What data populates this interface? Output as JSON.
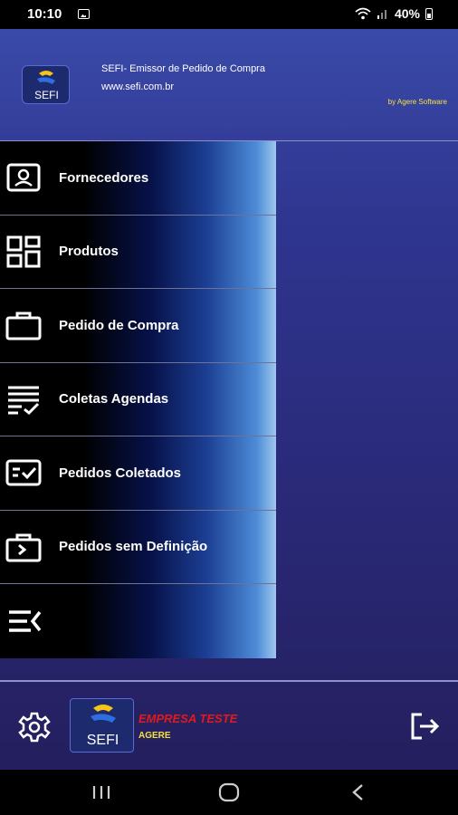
{
  "status_bar": {
    "time": "10:10",
    "battery": "40%"
  },
  "header": {
    "app_title": "SEFI- Emissor de Pedido de Compra",
    "app_url": "www.sefi.com.br",
    "by_line": "by Agere Software",
    "logo_text": "SEFI"
  },
  "menu": {
    "items": [
      {
        "label": "Fornecedores",
        "icon": "contact-card-icon"
      },
      {
        "label": "Produtos",
        "icon": "grid-icon"
      },
      {
        "label": "Pedido de Compra",
        "icon": "briefcase-icon"
      },
      {
        "label": "Coletas Agendas",
        "icon": "list-check-icon"
      },
      {
        "label": "Pedidos Coletados",
        "icon": "card-check-icon"
      },
      {
        "label": "Pedidos sem Definição",
        "icon": "briefcase-arrow-icon"
      },
      {
        "label": "",
        "icon": "collapse-menu-icon"
      }
    ]
  },
  "footer": {
    "company_name": "EMPRESA TESTE",
    "company_sub": "AGERE",
    "logo_text": "SEFI"
  },
  "colors": {
    "accent_yellow": "#f5e23a",
    "company_red": "#e01b1b",
    "background": "#2a2a7a"
  }
}
